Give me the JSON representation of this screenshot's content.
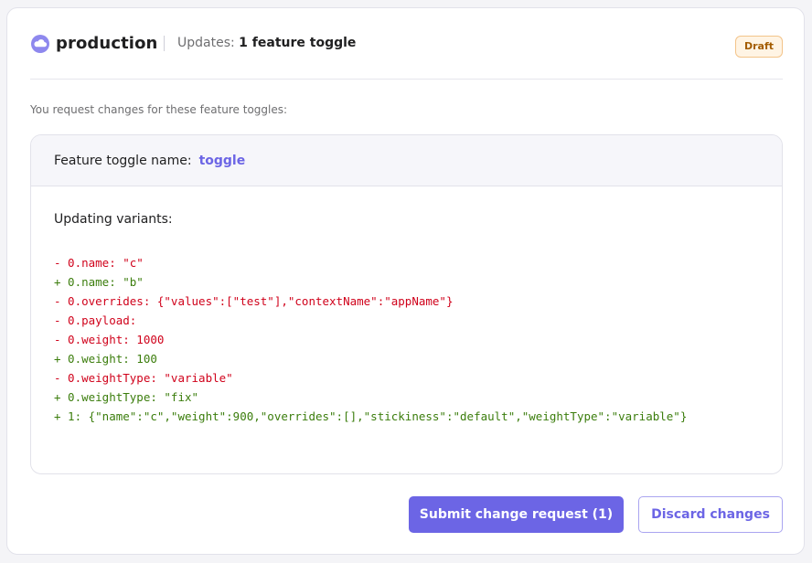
{
  "header": {
    "environment": "production",
    "env_icon": "cloud-icon",
    "updates_label": "Updates:",
    "updates_value": "1 feature toggle",
    "status_badge": "Draft"
  },
  "intro_text": "You request changes for these feature toggles:",
  "toggle": {
    "name_label": "Feature toggle name:",
    "name": "toggle",
    "variants_title": "Updating variants:",
    "diff_lines": [
      {
        "type": "rm",
        "text": "- 0.name: \"c\""
      },
      {
        "type": "add",
        "text": "+ 0.name: \"b\""
      },
      {
        "type": "rm",
        "text": "- 0.overrides: {\"values\":[\"test\"],\"contextName\":\"appName\"}"
      },
      {
        "type": "rm",
        "text": "- 0.payload:"
      },
      {
        "type": "rm",
        "text": "- 0.weight: 1000"
      },
      {
        "type": "add",
        "text": "+ 0.weight: 100"
      },
      {
        "type": "rm",
        "text": "- 0.weightType: \"variable\""
      },
      {
        "type": "add",
        "text": "+ 0.weightType: \"fix\""
      },
      {
        "type": "add",
        "text": "+ 1: {\"name\":\"c\",\"weight\":900,\"overrides\":[],\"stickiness\":\"default\",\"weightType\":\"variable\"}"
      }
    ]
  },
  "actions": {
    "submit_label": "Submit change request (1)",
    "discard_label": "Discard changes"
  },
  "colors": {
    "accent": "#6c65e5",
    "removed": "#d0021b",
    "added": "#3b7d0c",
    "badge_bg": "#fff4e4",
    "badge_text": "#a35c00"
  }
}
